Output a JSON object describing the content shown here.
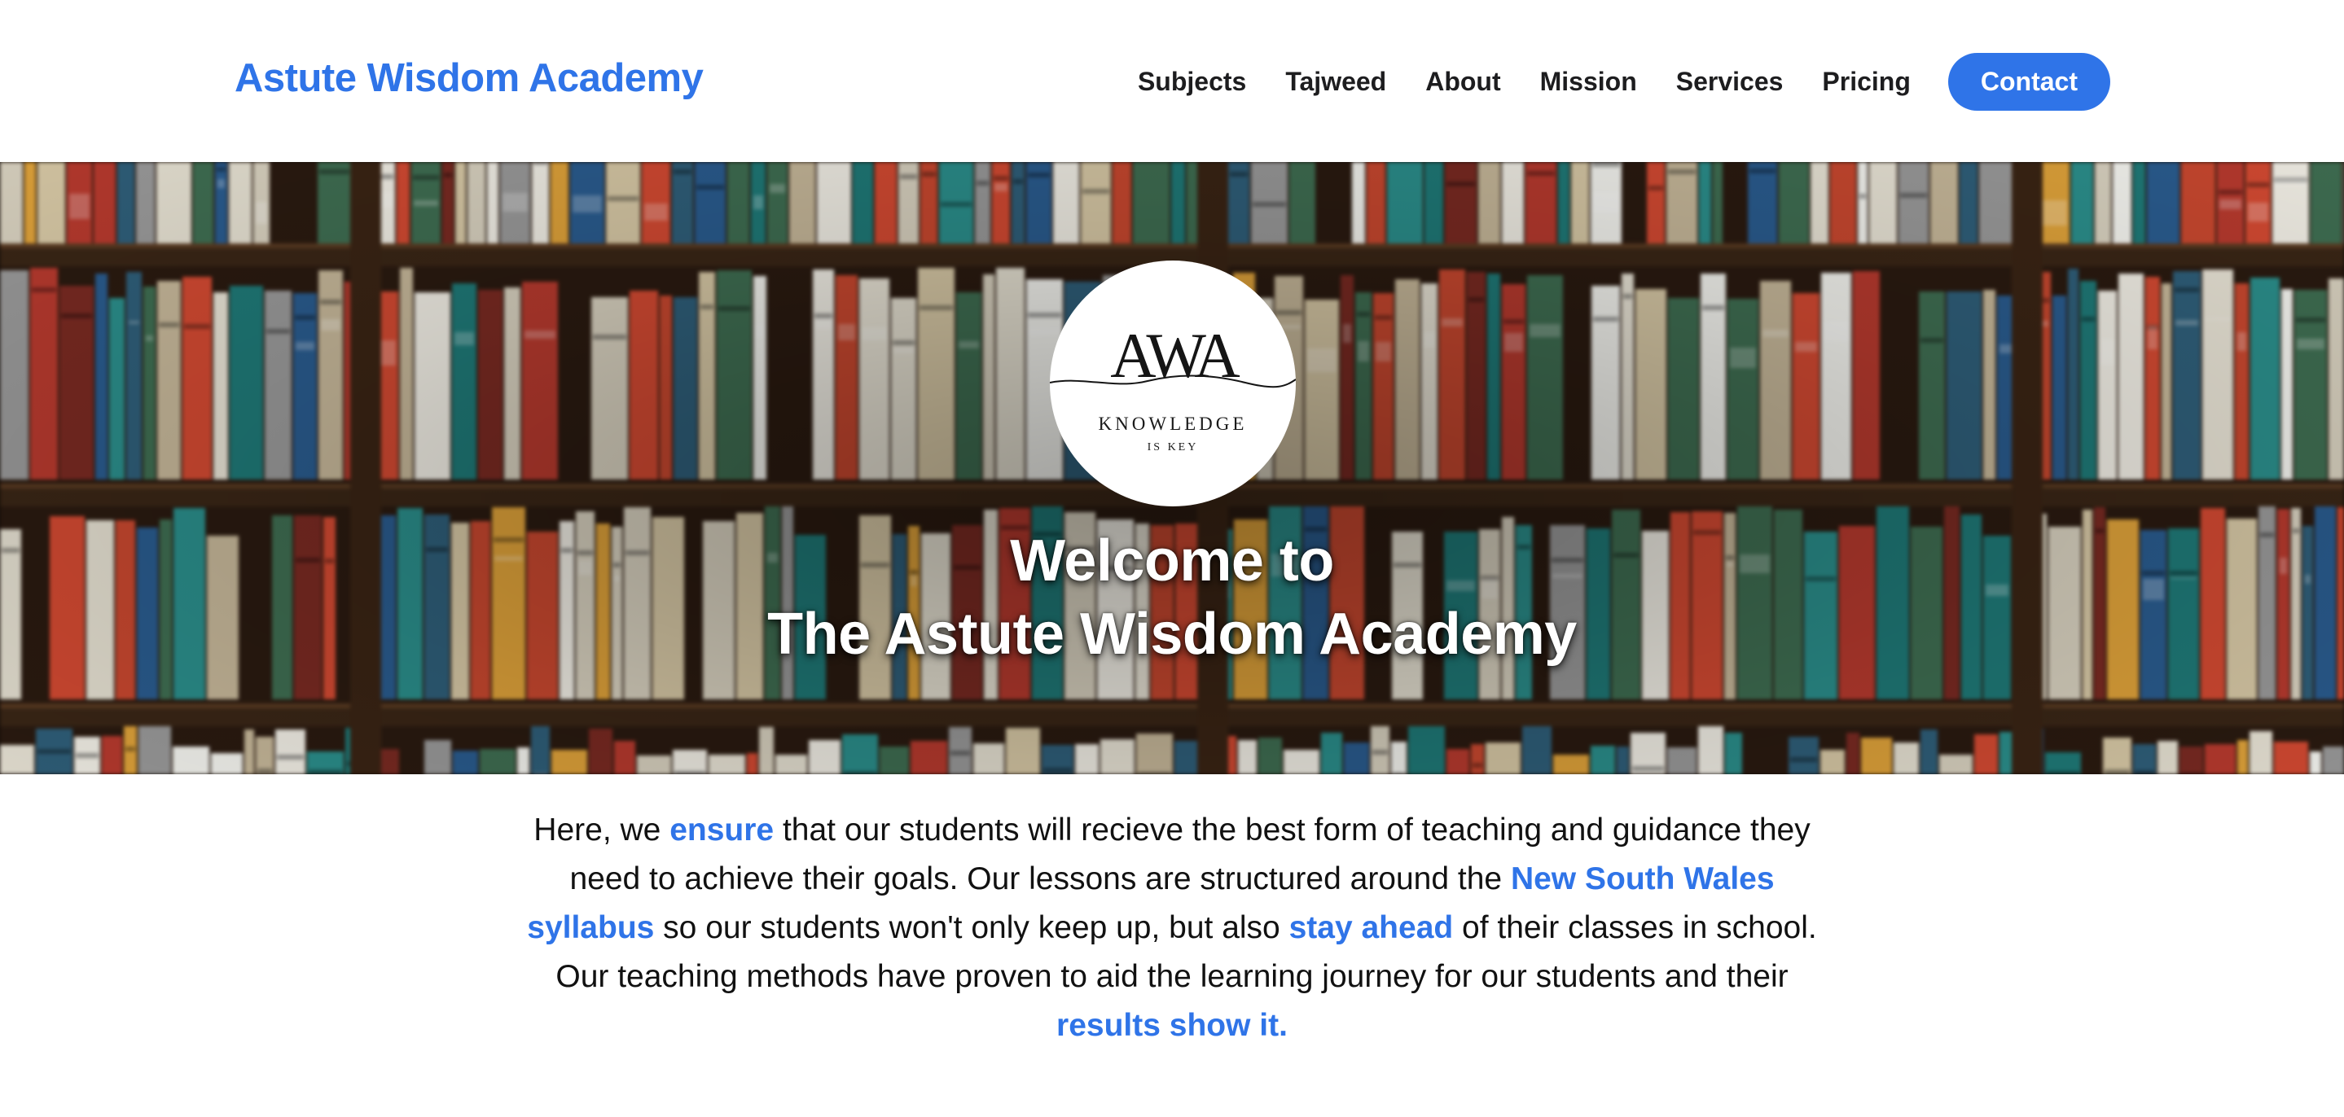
{
  "header": {
    "brand": "Astute Wisdom Academy",
    "nav": [
      {
        "label": "Subjects"
      },
      {
        "label": "Tajweed"
      },
      {
        "label": "About"
      },
      {
        "label": "Mission"
      },
      {
        "label": "Services"
      },
      {
        "label": "Pricing"
      }
    ],
    "contact_label": "Contact"
  },
  "hero": {
    "logo": {
      "mark": "AWA",
      "tagline": "KNOWLEDGE",
      "subtagline": "IS KEY"
    },
    "title_line1": "Welcome to",
    "title_line2": "The Astute Wisdom Academy",
    "background": "bookshelf-photo"
  },
  "intro": {
    "p1": "Here, we ",
    "h1": "ensure",
    "p2": " that our students will recieve the best form of teaching and guidance they need to achieve their goals. Our lessons are structured around the ",
    "h2": "New South Wales syllabus",
    "p3": " so our students won't only keep up, but also ",
    "h3": "stay ahead",
    "p4": " of their classes in school. Our teaching methods have proven to aid the learning journey for our students and their ",
    "h4": "results show it."
  },
  "colors": {
    "accent": "#2f74e8",
    "text": "#111111",
    "nav_text": "#1d1d1f",
    "background": "#ffffff"
  }
}
